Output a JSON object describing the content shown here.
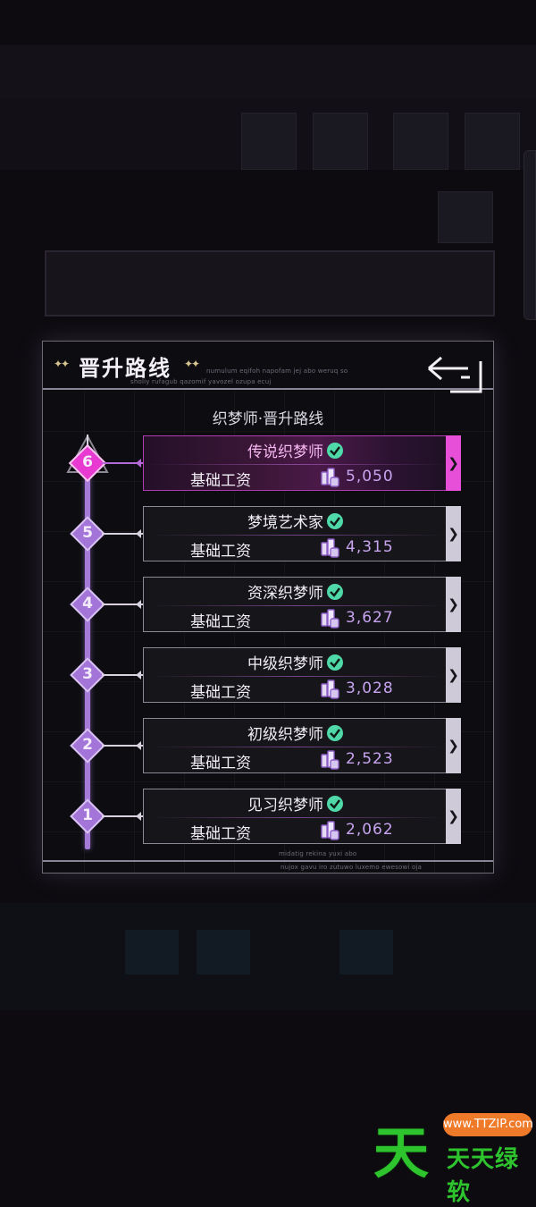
{
  "dialog": {
    "title": "晋升路线",
    "deco_line_1": "numulum eqifoh napofam jej abo weruq so",
    "deco_line_2": "sholiy rufagub qazomif yavozel ozupa ecuj",
    "subtitle": "织梦师·晋升路线",
    "footer_deco_1": "midatig rekina yuxi abo",
    "footer_deco_2": "nujox gavu iro zutuwo luxemo ewesowi oja",
    "back_icon": "return-arrow-icon"
  },
  "ranks": [
    {
      "level": "6",
      "title": "传说织梦师",
      "salary_label": "基础工资",
      "salary": "5,050",
      "active": true
    },
    {
      "level": "5",
      "title": "梦境艺术家",
      "salary_label": "基础工资",
      "salary": "4,315",
      "active": false
    },
    {
      "level": "4",
      "title": "资深织梦师",
      "salary_label": "基础工资",
      "salary": "3,627",
      "active": false
    },
    {
      "level": "3",
      "title": "中级织梦师",
      "salary_label": "基础工资",
      "salary": "3,028",
      "active": false
    },
    {
      "level": "2",
      "title": "初级织梦师",
      "salary_label": "基础工资",
      "salary": "2,523",
      "active": false
    },
    {
      "level": "1",
      "title": "见习织梦师",
      "salary_label": "基础工资",
      "salary": "2,062",
      "active": false
    }
  ],
  "colors": {
    "accent_purple": "#a475d8",
    "active_pink": "#e83ad1",
    "check_green": "#4fd8a8",
    "salary_text": "#c8a5f0"
  },
  "watermark": {
    "big": "天",
    "pill": "www.TTZIP.com",
    "text": "天天绿软"
  }
}
